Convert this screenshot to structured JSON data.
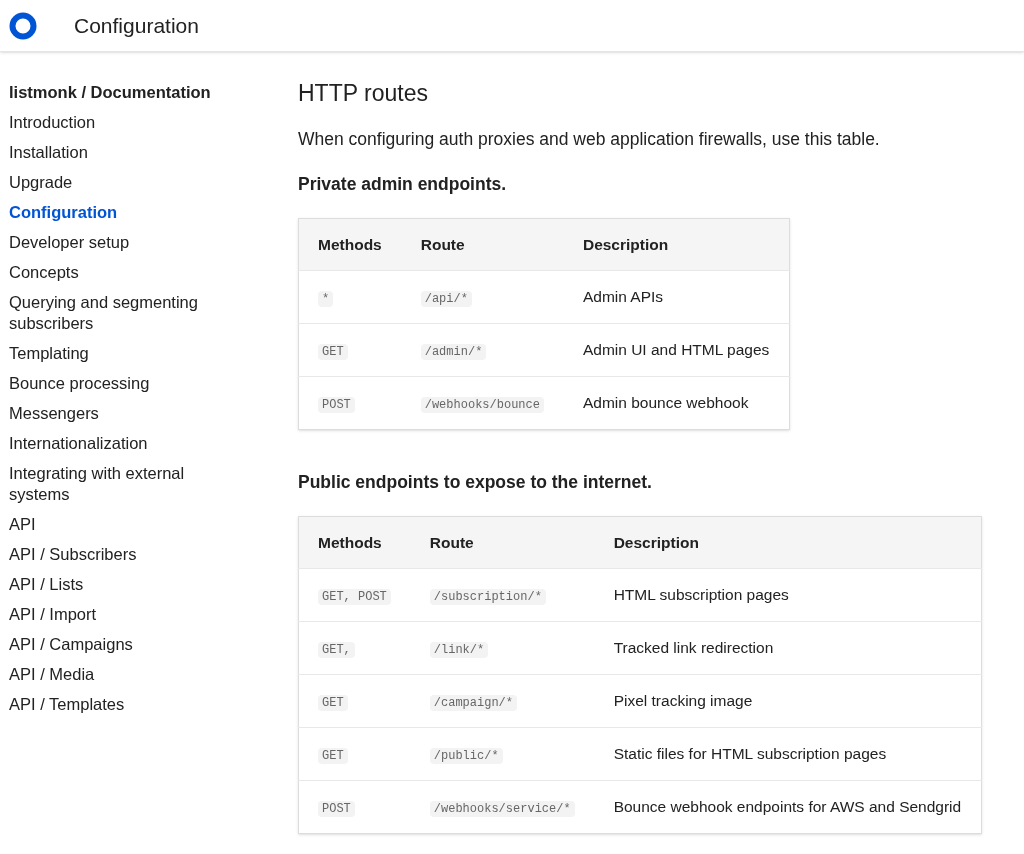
{
  "header": {
    "title": "Configuration"
  },
  "sidebar": {
    "title": "listmonk / Documentation",
    "items": [
      {
        "label": "Introduction",
        "selected": false
      },
      {
        "label": "Installation",
        "selected": false
      },
      {
        "label": "Upgrade",
        "selected": false
      },
      {
        "label": "Configuration",
        "selected": true
      },
      {
        "label": "Developer setup",
        "selected": false
      },
      {
        "label": "Concepts",
        "selected": false
      },
      {
        "label": "Querying and segmenting subscribers",
        "selected": false
      },
      {
        "label": "Templating",
        "selected": false
      },
      {
        "label": "Bounce processing",
        "selected": false
      },
      {
        "label": "Messengers",
        "selected": false
      },
      {
        "label": "Internationalization",
        "selected": false
      },
      {
        "label": "Integrating with external systems",
        "selected": false
      },
      {
        "label": "API",
        "selected": false
      },
      {
        "label": "API / Subscribers",
        "selected": false
      },
      {
        "label": "API / Lists",
        "selected": false
      },
      {
        "label": "API / Import",
        "selected": false
      },
      {
        "label": "API / Campaigns",
        "selected": false
      },
      {
        "label": "API / Media",
        "selected": false
      },
      {
        "label": "API / Templates",
        "selected": false
      }
    ]
  },
  "content": {
    "heading": "HTTP routes",
    "intro": "When configuring auth proxies and web application firewalls, use this table.",
    "sections": [
      {
        "title": "Private admin endpoints.",
        "table": {
          "columns": [
            "Methods",
            "Route",
            "Description"
          ],
          "rows": [
            [
              "*",
              "/api/*",
              "Admin APIs"
            ],
            [
              "GET",
              "/admin/*",
              "Admin UI and HTML pages"
            ],
            [
              "POST",
              "/webhooks/bounce",
              "Admin bounce webhook"
            ]
          ]
        }
      },
      {
        "title": "Public endpoints to expose to the internet.",
        "table": {
          "columns": [
            "Methods",
            "Route",
            "Description"
          ],
          "rows": [
            [
              "GET, POST",
              "/subscription/*",
              "HTML subscription pages"
            ],
            [
              "GET,",
              "/link/*",
              "Tracked link redirection"
            ],
            [
              "GET",
              "/campaign/*",
              "Pixel tracking image"
            ],
            [
              "GET",
              "/public/*",
              "Static files for HTML subscription pages"
            ],
            [
              "POST",
              "/webhooks/service/*",
              "Bounce webhook endpoints for AWS and Sendgrid"
            ]
          ]
        }
      }
    ]
  }
}
